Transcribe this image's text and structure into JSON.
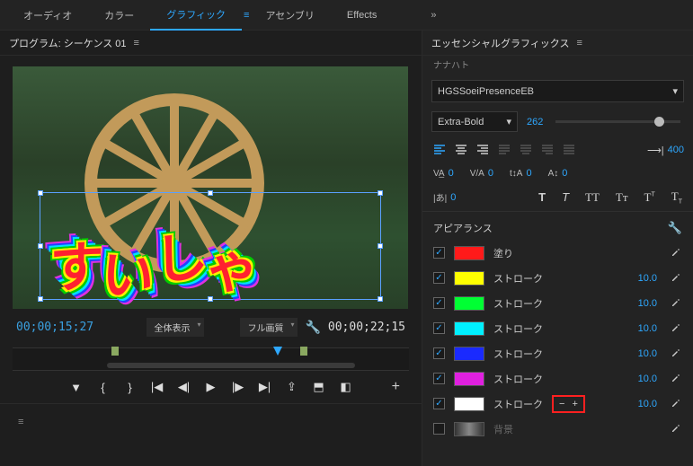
{
  "tabs": {
    "audio": "オーディオ",
    "color": "カラー",
    "graphics": "グラフィック",
    "assembly": "アセンブリ",
    "effects": "Effects",
    "expand": "»"
  },
  "program": {
    "title_prefix": "プログラム:",
    "sequence": "シーケンス 01",
    "overlay_text": "すいしゃ",
    "tc_current": "00;00;15;27",
    "tc_duration": "00;00;22;15",
    "fit": "全体表示",
    "quality": "フル画質"
  },
  "eg": {
    "title": "エッセンシャルグラフィックス",
    "subtitle": "ナナハト",
    "font": "HGSSoeiPresenceEB",
    "weight": "Extra-Bold",
    "size": "262",
    "tab_width": "400",
    "tracking": "0",
    "kerning": "0",
    "tsume": "0",
    "baseline": "0",
    "leading": "0"
  },
  "appearance": {
    "label": "アピアランス",
    "fill": "塗り",
    "stroke": "ストローク",
    "background": "背景",
    "rows": [
      {
        "type": "fill",
        "checked": true,
        "color": "#ff1a1a",
        "value": ""
      },
      {
        "type": "stroke",
        "checked": true,
        "color": "#ffff00",
        "value": "10.0"
      },
      {
        "type": "stroke",
        "checked": true,
        "color": "#00ff33",
        "value": "10.0"
      },
      {
        "type": "stroke",
        "checked": true,
        "color": "#00f0ff",
        "value": "10.0"
      },
      {
        "type": "stroke",
        "checked": true,
        "color": "#1a2aff",
        "value": "10.0"
      },
      {
        "type": "stroke",
        "checked": true,
        "color": "#e020e0",
        "value": "10.0"
      },
      {
        "type": "stroke",
        "checked": true,
        "color": "#ffffff",
        "value": "10.0"
      },
      {
        "type": "bg",
        "checked": false,
        "color": "gradient",
        "value": ""
      }
    ]
  }
}
